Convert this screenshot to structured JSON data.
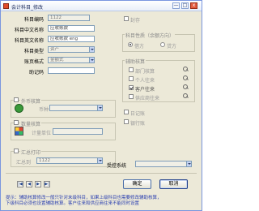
{
  "window": {
    "title": "会计科目_修改",
    "min_label": "—",
    "max_label": "□",
    "close_label": "x"
  },
  "form": {
    "code": {
      "label": "科目编码",
      "value": "1122"
    },
    "cn_name": {
      "label": "科目中文名称",
      "value": "应收账款"
    },
    "en_name": {
      "label": "科目英文名称",
      "value": "应收账款 eng"
    },
    "type": {
      "label": "科目类型",
      "value": "资产"
    },
    "format": {
      "label": "账页格式",
      "value": "金额式"
    },
    "mnemonic": {
      "label": "助记码",
      "value": ""
    }
  },
  "seal": {
    "label": "封存",
    "checked": false
  },
  "nature": {
    "title": "科目性质（余额方向）",
    "debit": {
      "label": "借方",
      "checked": true
    },
    "credit": {
      "label": "贷方",
      "checked": false
    }
  },
  "aux": {
    "title": "辅助核算",
    "items": [
      {
        "label": "部门核算",
        "checked": false
      },
      {
        "label": "个人往来",
        "checked": false
      },
      {
        "label": "客户往来",
        "checked": true
      },
      {
        "label": "供应商往来",
        "checked": false
      }
    ]
  },
  "foreign": {
    "title": "外币核算",
    "currency_label": "币种",
    "currency_value": ""
  },
  "quantity": {
    "title": "数量核算",
    "unit_label": "计量单位",
    "unit_value": ""
  },
  "summary": {
    "title": "汇总打印",
    "to_label": "汇总到",
    "to_value": "1122"
  },
  "journal": {
    "label": "日记账",
    "checked": false
  },
  "bank": {
    "label": "银行账",
    "checked": false
  },
  "receive_system": {
    "label": "受控系统",
    "value": ""
  },
  "nav": {
    "first": "|◀",
    "prev": "◀",
    "next": "▶",
    "last": "▶|"
  },
  "buttons": {
    "ok": "确定",
    "cancel": "取消"
  },
  "hint": "提示：辅助核算修改一般只针对末级科目，如果上级科目也需要修改辅助核算，\n下级科目必须也设置辅助核算。客户往来和供应商往来不能同时设置"
}
